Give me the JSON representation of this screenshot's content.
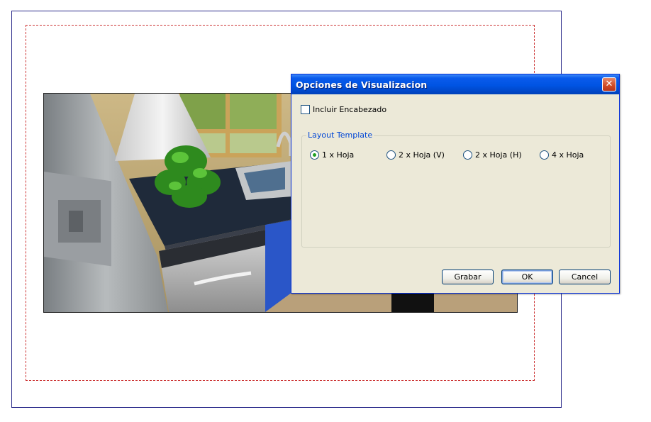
{
  "dialog": {
    "title": "Opciones de Visualizacion",
    "close_glyph": "✕",
    "include_header": {
      "label": "Incluir Encabezado",
      "checked": false
    },
    "layout_group": {
      "title": "Layout Template",
      "options": [
        {
          "label": "1 x Hoja",
          "selected": true
        },
        {
          "label": "2 x Hoja (V)",
          "selected": false
        },
        {
          "label": "2 x Hoja (H)",
          "selected": false
        },
        {
          "label": "4 x Hoja",
          "selected": false
        }
      ]
    },
    "buttons": {
      "save": "Grabar",
      "ok": "OK",
      "cancel": "Cancel"
    }
  },
  "icons": {
    "close": "close-icon"
  },
  "colors": {
    "title_bar": "#0054e3",
    "dialog_bg": "#ece9d8",
    "group_title": "#0046d5",
    "margin_guide": "#cc3333"
  }
}
